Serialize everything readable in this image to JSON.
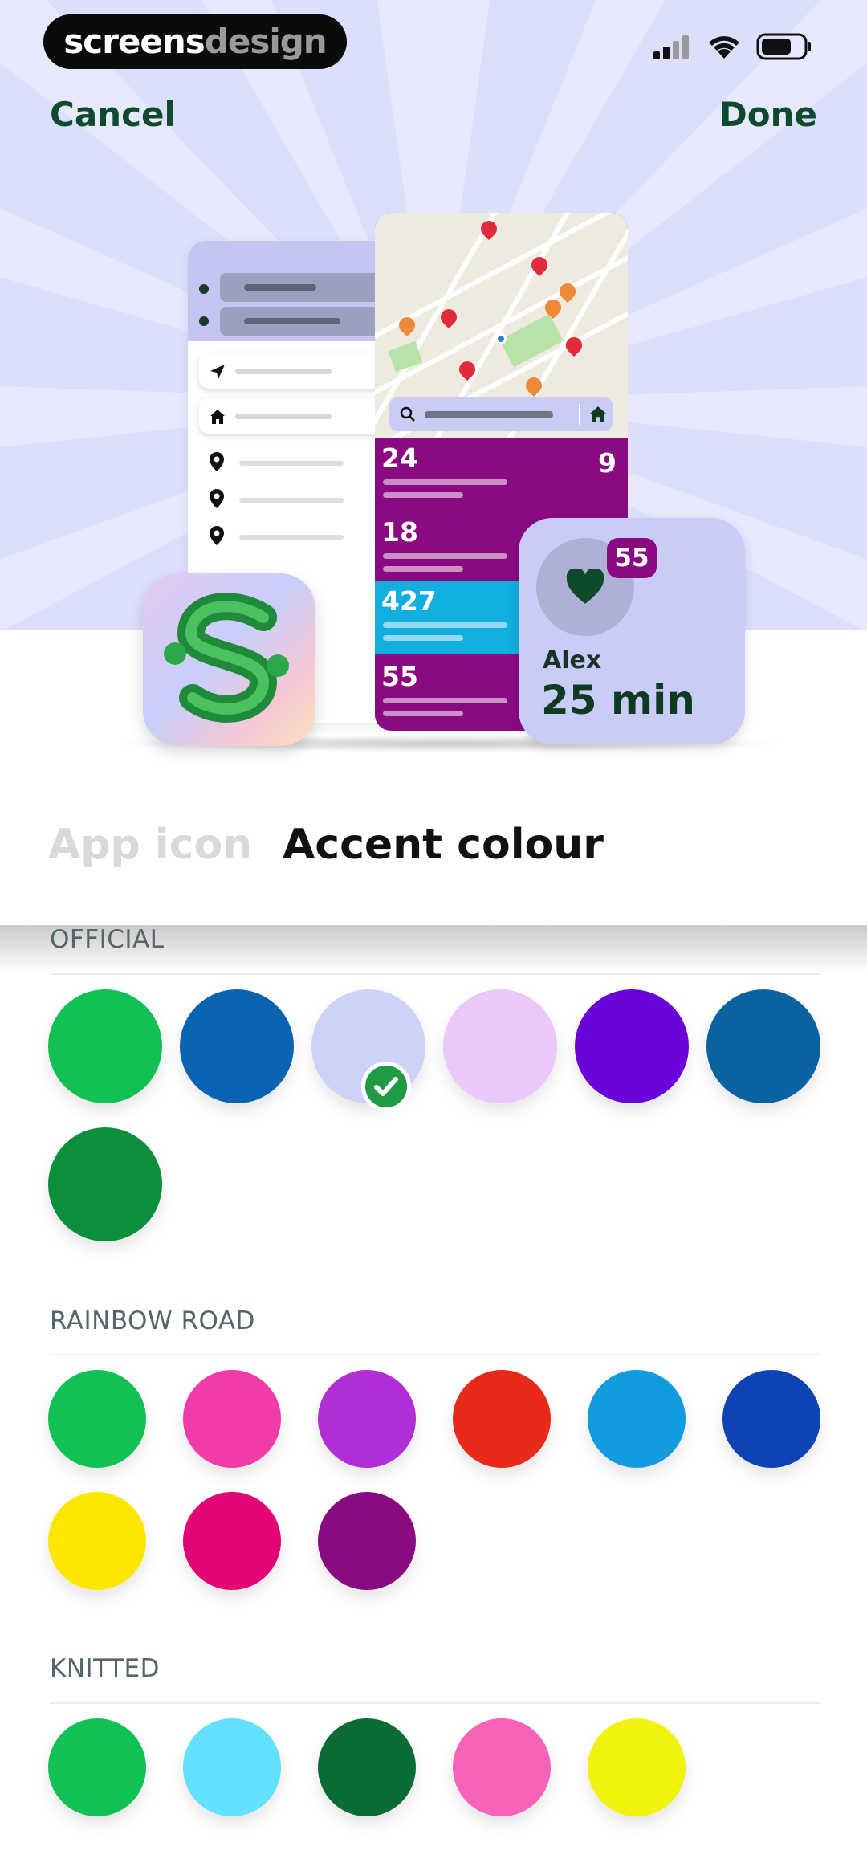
{
  "status_bar": {
    "brand_a": "screens",
    "brand_b": "design"
  },
  "nav": {
    "cancel_label": "Cancel",
    "done_label": "Done"
  },
  "illustration": {
    "stats": [
      {
        "value": "24",
        "side": "9",
        "color": "#8a0a82"
      },
      {
        "value": "18",
        "side": "",
        "color": "#8a0a82"
      },
      {
        "value": "427",
        "side": "",
        "color": "#12aee0"
      },
      {
        "value": "55",
        "side": "",
        "color": "#8a0a82"
      }
    ],
    "widget": {
      "badge": "55",
      "name": "Alex",
      "time": "25 min"
    }
  },
  "tabs": {
    "app_icon_label": "App icon",
    "accent_colour_label": "Accent colour"
  },
  "sections": [
    {
      "label": "OFFICIAL",
      "colors": [
        "#12c153",
        "#0a63b2",
        "#cdd2f9",
        "#ebc8fa",
        "#6b02d9",
        "#0a62a0",
        "#0b8f3c"
      ],
      "selected_index": 2
    },
    {
      "label": "RAINBOW ROAD",
      "colors": [
        "#12c153",
        "#f03ba8",
        "#b02ed6",
        "#e82a1a",
        "#139be0",
        "#0c44b4",
        "#fde700",
        "#e30575",
        "#8a0a82"
      ]
    },
    {
      "label": "KNITTED",
      "colors": [
        "#12c153",
        "#62e0ff",
        "#0a6b35",
        "#f863b9",
        "#f0f30d"
      ]
    }
  ],
  "icons": [
    "signal-icon",
    "wifi-icon",
    "battery-icon",
    "checkmark-icon",
    "heart-icon",
    "search-icon",
    "home-icon",
    "location-pin-icon",
    "navigation-arrow-icon"
  ]
}
